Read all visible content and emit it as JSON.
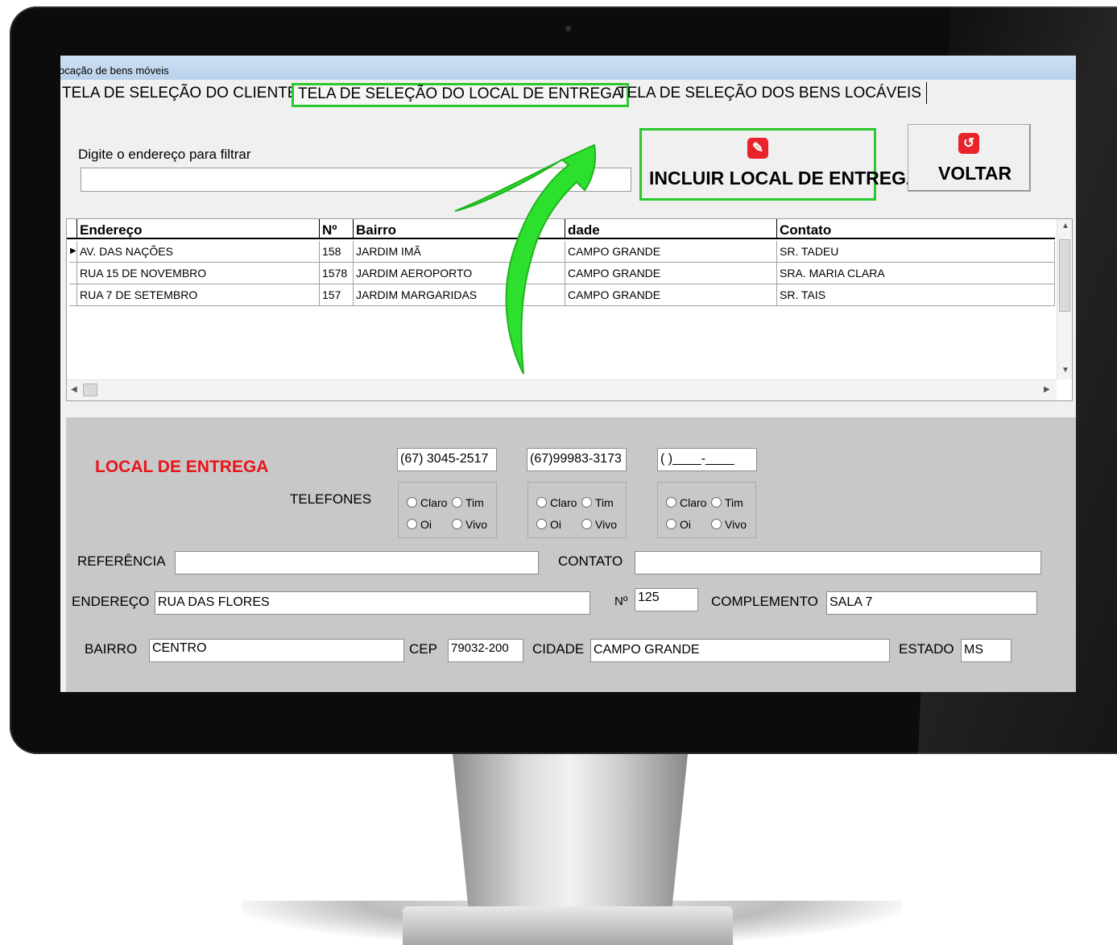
{
  "window": {
    "title": "ocação de bens móveis"
  },
  "tabs": [
    {
      "label": "TELA DE SELEÇÃO DO CLIENTE"
    },
    {
      "label": "TELA DE SELEÇÃO DO LOCAL DE ENTREGA",
      "active": true
    },
    {
      "label": "TELA DE SELEÇÃO DOS BENS LOCÁVEIS"
    }
  ],
  "filter": {
    "label": "Digite o endereço para filtrar",
    "value": ""
  },
  "buttons": {
    "incluir": {
      "label": "INCLUIR LOCAL DE ENTREGA",
      "icon": "edit-icon"
    },
    "voltar": {
      "label": "VOLTAR",
      "icon": "back-icon"
    }
  },
  "grid": {
    "columns": [
      "Endereço",
      "Nº",
      "Bairro",
      "dade",
      "Contato"
    ],
    "rows": [
      [
        "AV. DAS NAÇÕES",
        "158",
        "JARDIM IMÃ",
        "CAMPO GRANDE",
        "SR. TADEU"
      ],
      [
        "RUA 15 DE NOVEMBRO",
        "1578",
        "JARDIM AEROPORTO",
        "CAMPO GRANDE",
        "SRA. MARIA CLARA"
      ],
      [
        "RUA 7 DE SETEMBRO",
        "157",
        "JARDIM MARGARIDAS",
        "CAMPO GRANDE",
        "SR. TAIS"
      ]
    ]
  },
  "form": {
    "title": "LOCAL DE ENTREGA",
    "telefones_label": "TELEFONES",
    "phones": [
      "(67) 3045-2517",
      "(67)99983-3173",
      "( )____-____"
    ],
    "carriers": [
      "Claro",
      "Tim",
      "Oi",
      "Vivo"
    ],
    "referencia": {
      "label": "REFERÊNCIA",
      "value": ""
    },
    "contato": {
      "label": "CONTATO",
      "value": ""
    },
    "endereco": {
      "label": "ENDEREÇO",
      "value": "RUA DAS FLORES"
    },
    "numero": {
      "label": "Nº",
      "value": "125"
    },
    "complemento": {
      "label": "COMPLEMENTO",
      "value": "SALA 7"
    },
    "bairro": {
      "label": "BAIRRO",
      "value": "CENTRO"
    },
    "cep": {
      "label": "CEP",
      "value": "79032-200"
    },
    "cidade": {
      "label": "CIDADE",
      "value": "CAMPO GRANDE"
    },
    "estado": {
      "label": "ESTADO",
      "value": "MS"
    }
  },
  "colors": {
    "highlight": "#2cc82c",
    "title_red": "#e8141a",
    "icon_red": "#e8232a",
    "panel": "#c8c8c8"
  }
}
